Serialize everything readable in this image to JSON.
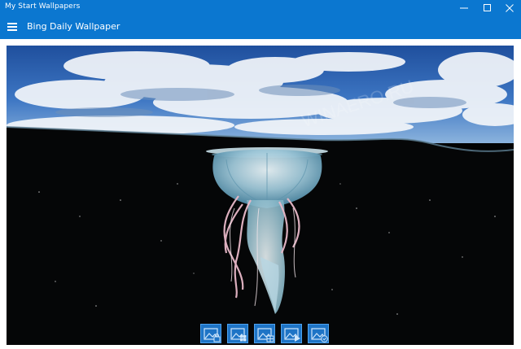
{
  "window": {
    "title": "My Start Wallpapers",
    "controls": [
      "minimize-icon",
      "maximize-icon",
      "close-icon"
    ]
  },
  "appbar": {
    "menu_icon": "hamburger-icon",
    "title": "Bing Daily Wallpaper"
  },
  "wallpaper": {
    "subject": "jellyfish-photo",
    "watermark": "WINAERO.RU"
  },
  "toolbar": {
    "buttons": [
      {
        "name": "set-lock-screen-button",
        "icon": "image-lock-icon"
      },
      {
        "name": "set-desktop-button",
        "icon": "image-windows-icon"
      },
      {
        "name": "set-start-button",
        "icon": "image-tiles-icon"
      },
      {
        "name": "slideshow-button",
        "icon": "image-play-icon"
      },
      {
        "name": "save-button",
        "icon": "image-save-icon"
      }
    ]
  },
  "colors": {
    "accent": "#0b77d0",
    "button_fill": "#1e74c6",
    "button_border": "#4ea2ee"
  }
}
